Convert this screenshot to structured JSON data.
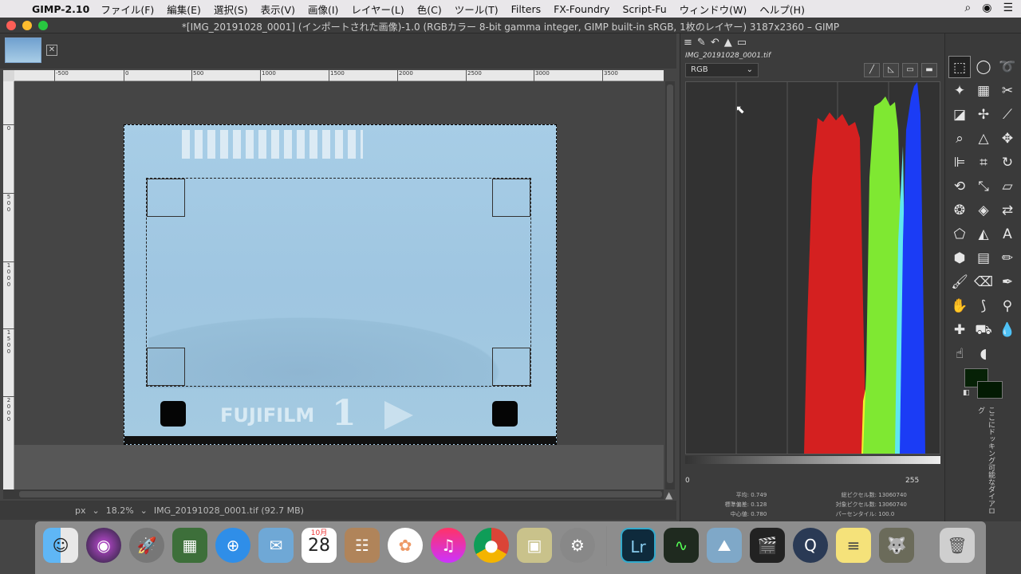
{
  "menubar": {
    "app_name": "GIMP-2.10",
    "items": [
      "ファイル(F)",
      "編集(E)",
      "選択(S)",
      "表示(V)",
      "画像(I)",
      "レイヤー(L)",
      "色(C)",
      "ツール(T)",
      "Filters",
      "FX-Foundry",
      "Script-Fu",
      "ウィンドウ(W)",
      "ヘルプ(H)"
    ]
  },
  "window": {
    "title": "*[IMG_20191028_0001] (インポートされた画像)-1.0 (RGBカラー 8-bit gamma integer, GIMP built-in sRGB, 1枚のレイヤー) 3187x2360 – GIMP",
    "lights": [
      "#fe5f57",
      "#febc2e",
      "#28c840"
    ]
  },
  "ruler": {
    "h_ticks": [
      "-500",
      "0",
      "500",
      "1000",
      "1500",
      "2000",
      "2500",
      "3000",
      "3500"
    ],
    "v_ticks": [
      "0",
      "5\n0\n0",
      "1\n0\n0\n0",
      "1\n5\n0\n0",
      "2\n0\n0\n0"
    ]
  },
  "image": {
    "film_text": "FUJIFILM",
    "frame_number": "1"
  },
  "statusbar": {
    "unit": "px",
    "zoom": "18.2%",
    "file_info": "IMG_20191028_0001.tif (92.7 MB)"
  },
  "histogram": {
    "filename": "IMG_20191028_0001.tif",
    "channel": "RGB",
    "range_low": "0",
    "range_high": "255",
    "stats": {
      "mean_label": "平均:",
      "mean": "0.749",
      "std_label": "標準偏差:",
      "std": "0.128",
      "median_label": "中心値:",
      "median": "0.780",
      "pixels_label": "総ピクセル数:",
      "pixels": "13060740",
      "count_label": "対象ピクセル数:",
      "count": "13060740",
      "percentile_label": "パーセンタイル:",
      "percentile": "100.0"
    },
    "colors": {
      "red": "#d42020",
      "green": "#7fe832",
      "cyan": "#5fe7f0",
      "blue": "#1b3cf5",
      "yellow": "#f2f22a"
    }
  },
  "toolbox": {
    "dock_hint": "ここにドッキング可能なダイアログ"
  },
  "dock": {
    "calendar_month": "10月",
    "calendar_day": "28"
  }
}
